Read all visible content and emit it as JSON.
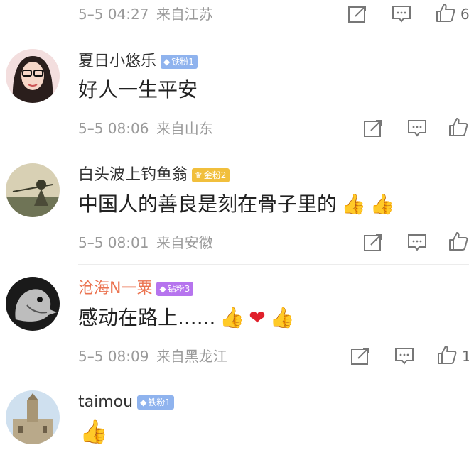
{
  "comments": [
    {
      "meta_time": "5–5 04:27",
      "meta_source": "来自江苏",
      "like_count": "6"
    },
    {
      "username": "夏日小悠乐",
      "badge": "铁粉1",
      "text": "好人一生平安",
      "meta_time": "5–5 08:06",
      "meta_source": "来自山东"
    },
    {
      "username": "白头波上钓鱼翁",
      "badge": "金粉2",
      "text": "中国人的善良是刻在骨子里的",
      "meta_time": "5–5 08:01",
      "meta_source": "来自安徽"
    },
    {
      "username": "沧海N一粟",
      "badge": "钻粉3",
      "text": "感动在路上......",
      "meta_time": "5–5 08:09",
      "meta_source": "来自黑龙江",
      "like_count": "1"
    },
    {
      "username": "taimou",
      "badge": "铁粉1"
    }
  ],
  "colors": {
    "meta_gray": "#9a9a9a",
    "orange_name": "#eb7350",
    "iron_badge": "#8fb3ee",
    "gold_badge": "#f1bf3c",
    "diamond_badge": "#b674ee"
  },
  "icons": [
    "share-icon",
    "comment-icon",
    "like-icon",
    "thumbs-up-emoji",
    "heart-emoji"
  ]
}
